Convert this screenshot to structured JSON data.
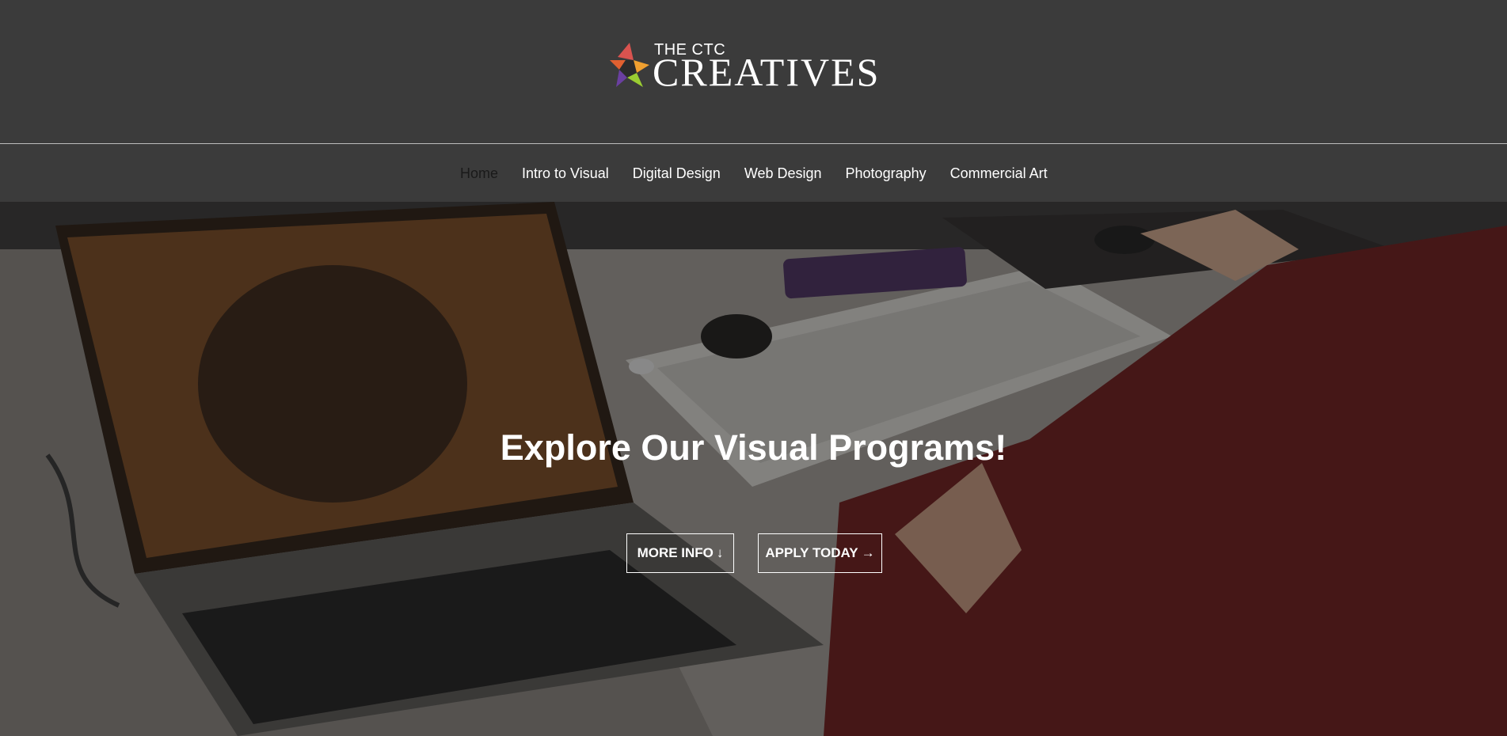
{
  "header": {
    "logo_small": "THE CTC",
    "logo_big": "CREATIVES"
  },
  "nav": {
    "items": [
      {
        "label": "Home",
        "active": true
      },
      {
        "label": "Intro to Visual",
        "active": false
      },
      {
        "label": "Digital Design",
        "active": false
      },
      {
        "label": "Web Design",
        "active": false
      },
      {
        "label": "Photography",
        "active": false
      },
      {
        "label": "Commercial Art",
        "active": false
      }
    ]
  },
  "hero": {
    "title": "Explore Our Visual Programs!",
    "more_info_label": "MORE INFO",
    "more_info_arrow": "↓",
    "apply_label": "APPLY TODAY",
    "apply_arrow": "→"
  },
  "colors": {
    "header_bg": "#3b3b3b",
    "nav_active": "#1a1a1a",
    "text": "#ffffff"
  }
}
